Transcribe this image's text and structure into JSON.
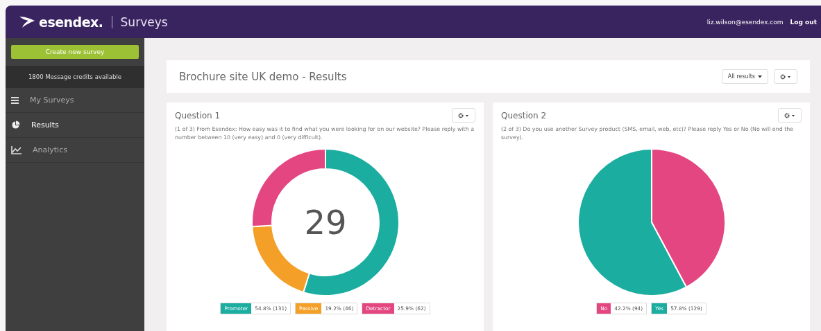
{
  "header": {
    "brand": "esendex.",
    "product": "Surveys",
    "user": "liz.wilson@esendex.com",
    "logout": "Log out"
  },
  "sidebar": {
    "create_button": "Create new survey",
    "credits": "1800 Message credits available",
    "items": [
      {
        "label": "My Surveys",
        "kind": "list",
        "selected": false
      },
      {
        "label": "Results",
        "kind": "pie",
        "selected": true
      },
      {
        "label": "Analytics",
        "kind": "trend",
        "selected": false
      }
    ]
  },
  "page": {
    "title": "Brochure site UK demo - Results",
    "filter": "All results"
  },
  "questions": [
    {
      "title": "Question 1",
      "text": "(1 of 3) From Esendex: How easy was it to find what you were looking for on our website? Please reply with a number between 10 (very easy) and 0 (very difficult).",
      "center": "29",
      "chart_data": {
        "type": "donut",
        "categories": [
          "Promoter",
          "Passive",
          "Detractor"
        ],
        "values": [
          54.8,
          19.2,
          25.9
        ]
      },
      "legend": [
        {
          "value": "54.8% (131)",
          "color": "#1aada0"
        },
        {
          "value": "19.2% (46)",
          "color": "#f4a028"
        },
        {
          "value": "25.9% (62)",
          "color": "#e44681"
        }
      ]
    },
    {
      "title": "Question 2",
      "text": "(2 of 3) Do you use another Survey product (SMS, email, web, etc)? Please reply Yes or No (No will end the survey).",
      "chart_data": {
        "type": "pie",
        "categories": [
          "No",
          "Yes"
        ],
        "values": [
          42.2,
          57.8
        ]
      },
      "legend": [
        {
          "value": "42.2% (94)",
          "color": "#e44681"
        },
        {
          "value": "57.8% (129)",
          "color": "#1aada0"
        }
      ]
    }
  ]
}
